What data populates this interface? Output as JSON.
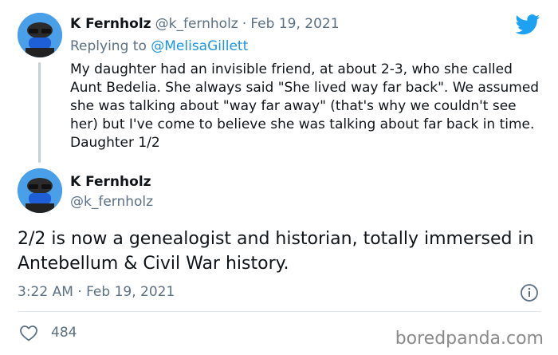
{
  "reply_tweet": {
    "author_name": "K Fernholz",
    "author_handle": "@k_fernholz",
    "separator": "·",
    "date": "Feb 19, 2021",
    "replying_prefix": "Replying to",
    "replying_to": "@MelisaGillett",
    "text": "My daughter had an invisible friend, at about 2-3, who she called Aunt Bedelia. She always said \"She lived way far back\". We assumed she was talking about \"way far away\" (that's why we couldn't see her) but I've come to believe she was talking about far back in time. Daughter 1/2"
  },
  "main_tweet": {
    "author_name": "K Fernholz",
    "author_handle": "@k_fernholz",
    "text": "2/2 is now a genealogist and historian, totally immersed in Antebellum & Civil War history.",
    "timestamp": "3:22 AM · Feb 19, 2021",
    "like_count": "484"
  },
  "watermark": "boredpanda.com",
  "colors": {
    "twitter_blue": "#1da1f2",
    "link_blue": "#1b95e0",
    "muted": "#5b7083"
  },
  "icons": [
    "twitter-bird-icon",
    "info-icon",
    "heart-icon"
  ]
}
